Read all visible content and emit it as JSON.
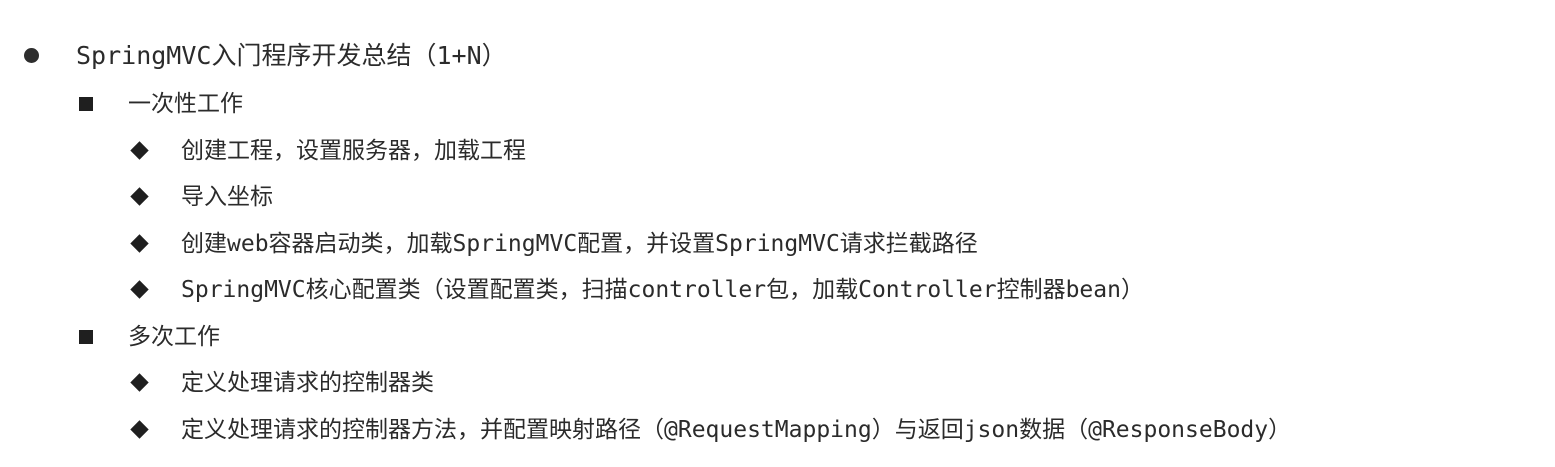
{
  "outline": {
    "title": "SpringMVC入门程序开发总结（1+N）",
    "sections": [
      {
        "heading": "一次性工作",
        "items": [
          "创建工程，设置服务器，加载工程",
          "导入坐标",
          "创建web容器启动类，加载SpringMVC配置，并设置SpringMVC请求拦截路径",
          "SpringMVC核心配置类（设置配置类，扫描controller包，加载Controller控制器bean）"
        ]
      },
      {
        "heading": "多次工作",
        "items": [
          "定义处理请求的控制器类",
          "定义处理请求的控制器方法，并配置映射路径（@RequestMapping）与返回json数据（@ResponseBody）"
        ]
      }
    ]
  }
}
